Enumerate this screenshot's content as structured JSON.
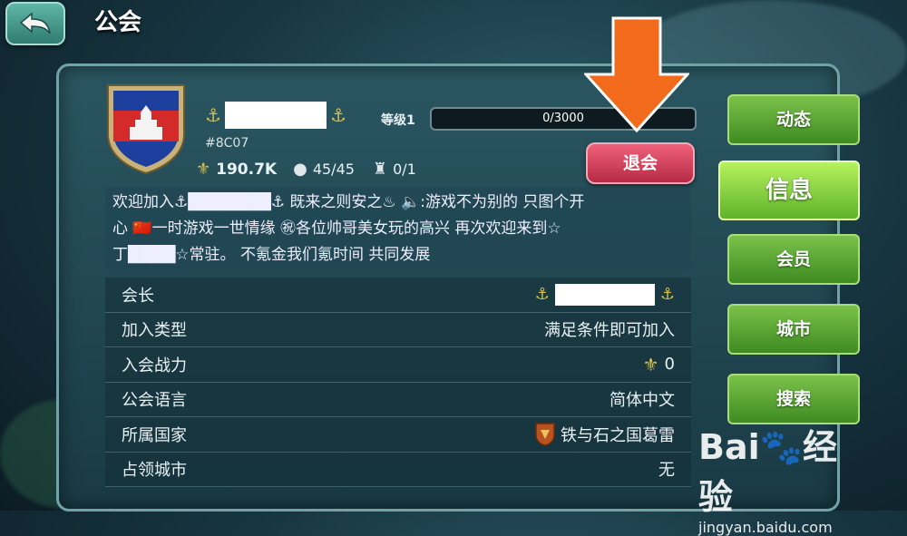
{
  "header": {
    "title": "公会"
  },
  "guild": {
    "id": "#8C07",
    "power": "190.7K",
    "members": "45/45",
    "cities": "0/1",
    "level_label": "等级1",
    "exp_text": "0/3000",
    "exp_progress": 0.0
  },
  "actions": {
    "leave_label": "退会"
  },
  "description": {
    "line1": "欢迎加入⚓███████⚓  既来之则安之♨  🔈:游戏不为别的 只图个开",
    "line2": "心 🇨🇳一时游戏一世情缘  ㊗各位帅哥美女玩的高兴  再次欢迎来到☆",
    "line3": "丁████☆常驻。 不氪金我们氪时间 共同发展"
  },
  "info_rows": [
    {
      "label": "会长",
      "value": ""
    },
    {
      "label": "加入类型",
      "value": "满足条件即可加入"
    },
    {
      "label": "入会战力",
      "value": "0"
    },
    {
      "label": "公会语言",
      "value": "简体中文"
    },
    {
      "label": "所属国家",
      "value": "铁与石之国葛雷"
    },
    {
      "label": "占领城市",
      "value": "无"
    }
  ],
  "tabs": [
    {
      "label": "动态"
    },
    {
      "label": "信息"
    },
    {
      "label": "会员"
    },
    {
      "label": "城市"
    },
    {
      "label": "搜索"
    }
  ],
  "watermark": {
    "logo": "Bai🐾经验",
    "url": "jingyan.baidu.com"
  },
  "colors": {
    "accent_green": "#7bc24a",
    "leave_red": "#d83a55",
    "arrow_orange": "#f26a1b"
  }
}
